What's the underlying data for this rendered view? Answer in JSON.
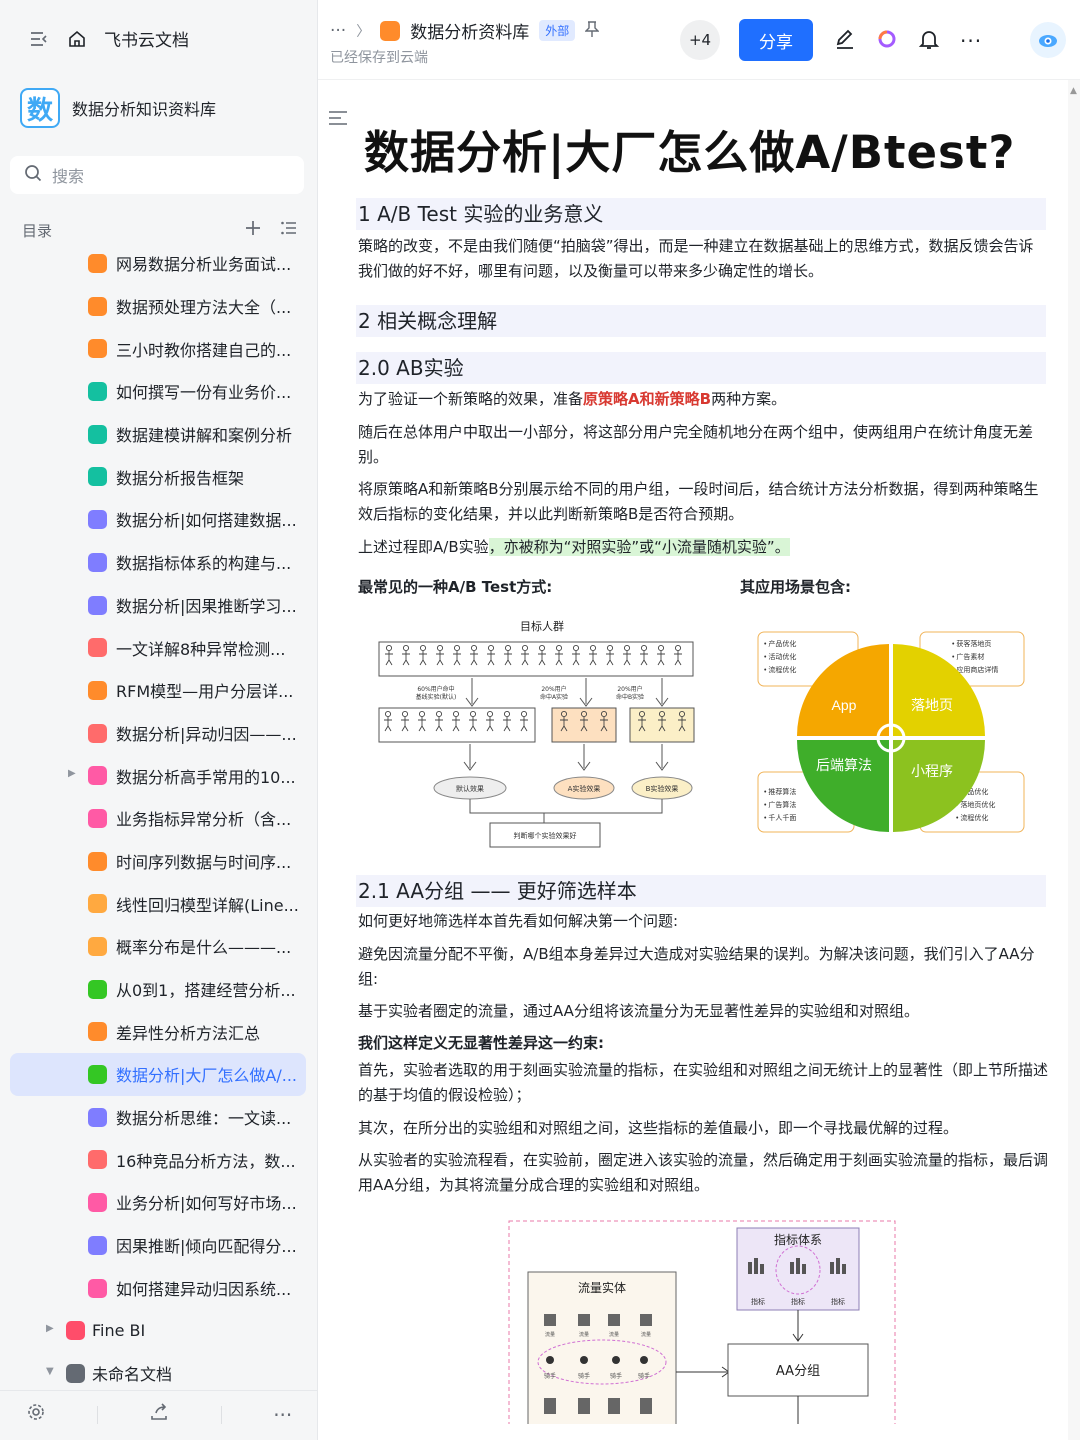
{
  "sidebar": {
    "home_label": "飞书云文档",
    "space_logo": "数",
    "space_name": "数据分析知识资料库",
    "search_placeholder": "搜索",
    "toc_label": "目录",
    "items": [
      {
        "label": "网易数据分析业务面试...",
        "color": "#ff8b2b",
        "level": 1
      },
      {
        "label": "数据预处理方法大全（...",
        "color": "#ff8b2b",
        "level": 1
      },
      {
        "label": "三小时教你搭建自己的...",
        "color": "#ff8b2b",
        "level": 1
      },
      {
        "label": "如何撰写一份有业务价...",
        "color": "#14c0a0",
        "level": 1
      },
      {
        "label": "数据建模讲解和案例分析",
        "color": "#14c0a0",
        "level": 1
      },
      {
        "label": "数据分析报告框架",
        "color": "#14c0a0",
        "level": 1
      },
      {
        "label": "数据分析|如何搭建数据...",
        "color": "#7f7dff",
        "level": 1
      },
      {
        "label": "数据指标体系的构建与...",
        "color": "#7f7dff",
        "level": 1
      },
      {
        "label": "数据分析|因果推断学习...",
        "color": "#7f7dff",
        "level": 1
      },
      {
        "label": "一文详解8种异常检测...",
        "color": "#ff6b6b",
        "level": 1
      },
      {
        "label": "RFM模型—用户分层详...",
        "color": "#ff8b2b",
        "level": 1
      },
      {
        "label": "数据分析|异动归因——...",
        "color": "#ff6b6b",
        "level": 1
      },
      {
        "label": "数据分析高手常用的10...",
        "color": "#ff5aa5",
        "level": 1,
        "caret": "▶"
      },
      {
        "label": "业务指标异常分析（含...",
        "color": "#ff5aa5",
        "level": 1
      },
      {
        "label": "时间序列数据与时间序...",
        "color": "#ff8b2b",
        "level": 1
      },
      {
        "label": "线性回归模型详解(Line...",
        "color": "#ffa940",
        "level": 1
      },
      {
        "label": "概率分布是什么———...",
        "color": "#ffa940",
        "level": 1
      },
      {
        "label": "从0到1，搭建经营分析...",
        "color": "#34c724",
        "level": 1
      },
      {
        "label": "差异性分析方法汇总",
        "color": "#ff8b2b",
        "level": 1
      },
      {
        "label": "数据分析|大厂怎么做A/...",
        "color": "#34c724",
        "level": 1,
        "active": true
      },
      {
        "label": "数据分析思维：一文读...",
        "color": "#7f7dff",
        "level": 1
      },
      {
        "label": "16种竞品分析方法，数...",
        "color": "#ff6b6b",
        "level": 1
      },
      {
        "label": "业务分析|如何写好市场...",
        "color": "#ff5aa5",
        "level": 1
      },
      {
        "label": "因果推断|倾向匹配得分...",
        "color": "#7f7dff",
        "level": 1
      },
      {
        "label": "如何搭建异动归因系统...",
        "color": "#ff5aa5",
        "level": 1
      },
      {
        "label": "Fine BI",
        "color": "#ff4d6a",
        "level": 0,
        "caret": "▶"
      },
      {
        "label": "未命名文档",
        "color": "#646a73",
        "level": 0,
        "caret": "▼"
      }
    ]
  },
  "header": {
    "more": "···",
    "title": "数据分析资料库",
    "badge": "外部",
    "saved": "已经保存到云端",
    "collaborators": "+4",
    "share_label": "分享"
  },
  "doc": {
    "title": "数据分析|大厂怎么做A/Btest?",
    "h1": "1 A/B Test 实验的业务意义",
    "p1": "策略的改变，不是由我们随便“拍脑袋”得出，而是一种建立在数据基础上的思维方式，数据反馈会告诉我们做的好不好，哪里有问题，以及衡量可以带来多少确定性的增长。",
    "h2": "2 相关概念理解",
    "h3": "2.0 AB实验",
    "p2_a": "为了验证一个新策略的效果，准备",
    "p2_red": "原策略A和新策略B",
    "p2_b": "两种方案。",
    "p3": "随后在总体用户中取出一小部分，将这部分用户完全随机地分在两个组中，使两组用户在统计角度无差别。",
    "p4": "将原策略A和新策略B分别展示给不同的用户组，一段时间后，结合统计方法分析数据，得到两种策略生效后指标的变化结果，并以此判断新策略B是否符合预期。",
    "p5_a": "上述过程即A/B实验",
    "p5_hl": "，亦被称为“对照实验”或“小流量随机实验”。",
    "cap1": "最常见的一种A/B Test方式:",
    "cap2": "其应用场景包含:",
    "h4": "2.1 AA分组 —— 更好筛选样本",
    "p6": "如何更好地筛选样本首先看如何解决第一个问题:",
    "p7": "避免因流量分配不平衡，A/B组本身差异过大造成对实验结果的误判。为解决该问题，我们引入了AA分组:",
    "p8": "基于实验者圈定的流量，通过AA分组将该流量分为无显著性差异的实验组和对照组。",
    "p9": "我们这样定义无显著性差异这一约束:",
    "p10": "首先，实验者选取的用于刻画实验流量的指标，在实验组和对照组之间无统计上的显著性（即上节所描述的基于均值的假设检验）；",
    "p11": "其次，在所分出的实验组和对照组之间，这些指标的差值最小，即一个寻找最优解的过程。",
    "p12": "从实验者的实验流程看，在实验前，圈定进入该实验的流量，然后确定用于刻画实验流量的指标，最后调用AA分组，为其将流量分成合理的实验组和对照组。"
  },
  "fig1": {
    "top": "目标人群",
    "s1": "60%用户命中",
    "s1b": "基线实验(默认)",
    "s2": "20%用户",
    "s2b": "命中A实验",
    "s3": "20%用户",
    "s3b": "命中B实验",
    "e0": "默认效果",
    "e1": "A实验效果",
    "e2": "B实验效果",
    "judge": "判断哪个实验效果好"
  },
  "fig2": {
    "q1": "App",
    "q2": "落地页",
    "q3": "后端算法",
    "q4": "小程序",
    "tl": [
      "• 产品优化",
      "• 活动优化",
      "• 流程优化"
    ],
    "tr": [
      "• 获客落地页",
      "• 广告素材",
      "• 应用商店详情"
    ],
    "bl": [
      "• 推荐算法",
      "• 广告算法",
      "• 千人千面"
    ],
    "br": [
      "• 产品优化",
      "• 落地页优化",
      "• 流程优化"
    ],
    "colors": {
      "q1": "#f5a700",
      "q2": "#e8d400",
      "q3": "#3fae2a",
      "q4": "#8cc21f"
    }
  },
  "fig3": {
    "metrics_title": "指标体系",
    "m1": "指标",
    "m2": "指标",
    "m3": "指标",
    "flow_title": "流量实体",
    "small": "流量",
    "rider": "骑手",
    "aa": "AA分组"
  }
}
